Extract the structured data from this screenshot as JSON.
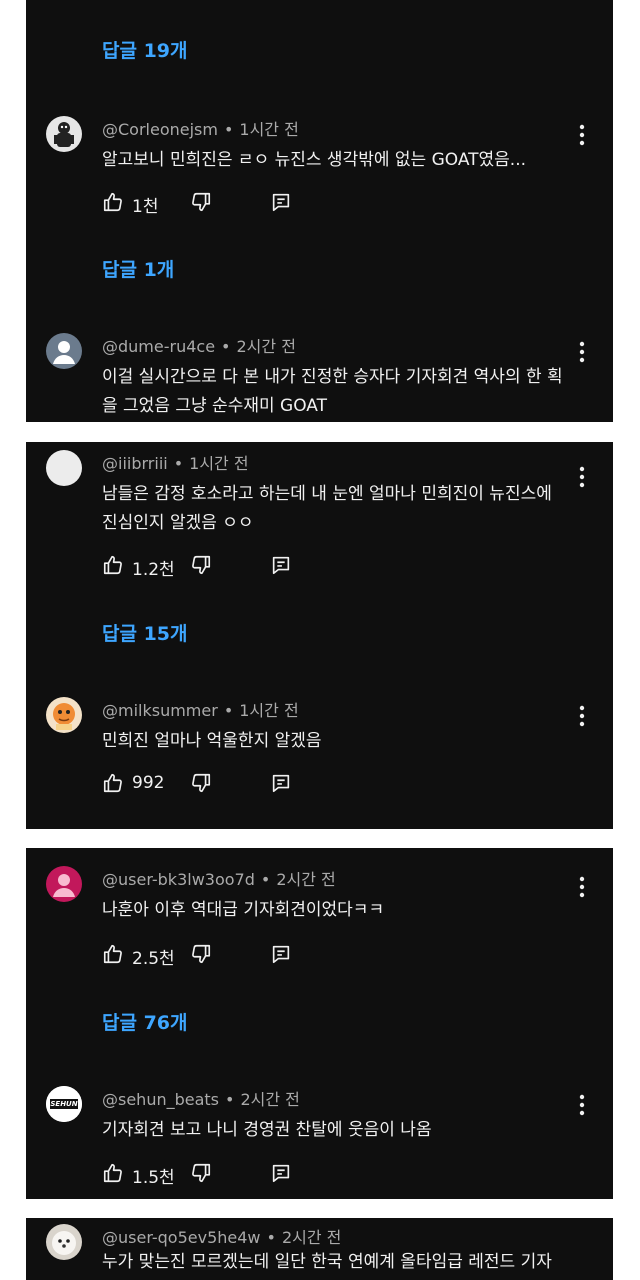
{
  "panel1": {
    "top_replies": "답글 19개",
    "comment": {
      "handle": "@Corleonejsm",
      "time": "1시간 전",
      "text": "알고보니 민희진은 ㄹㅇ 뉴진스 생각밖에 없는 GOAT였음...",
      "likes": "1천"
    },
    "replies": "답글 1개",
    "comment2": {
      "handle": "@dume-ru4ce",
      "time": "2시간 전",
      "text": "이걸 실시간으로 다 본 내가 진정한 승자다 기자회견 역사의 한 획을 그었음 그냥 순수재미 GOAT"
    }
  },
  "panel2": {
    "comment": {
      "handle": "@iiibrriii",
      "time": "1시간 전",
      "text": "남들은 감정 호소라고 하는데 내 눈엔 얼마나 민희진이 뉴진스에 진심인지 알겠음 ㅇㅇ",
      "likes": "1.2천"
    },
    "replies": "답글 15개",
    "comment2": {
      "handle": "@milksummer",
      "time": "1시간 전",
      "text": "민희진 얼마나 억울한지 알겠음",
      "likes": "992"
    }
  },
  "panel3": {
    "comment": {
      "handle": "@user-bk3lw3oo7d",
      "time": "2시간 전",
      "text": "나훈아 이후 역대급 기자회견이었다ㅋㅋ",
      "likes": "2.5천"
    },
    "replies": "답글 76개",
    "comment2": {
      "handle": "@sehun_beats",
      "time": "2시간 전",
      "text": "기자회견 보고 나니 경영권 찬탈에 웃음이 나옴",
      "likes": "1.5천",
      "avatar_text": "SEHUN"
    }
  },
  "panel4": {
    "comment": {
      "handle": "@user-qo5ev5he4w",
      "time": "2시간 전",
      "text": "누가 맞는진 모르겠는데 일단 한국 연예계 올타임급 레전드 기자"
    }
  },
  "colors": {
    "panel_bg": "#0f0f0f",
    "link_blue": "#3ea6ff",
    "text": "#f1f1f1",
    "meta": "#aaaaaa"
  },
  "icons": [
    "thumbs-up-icon",
    "thumbs-down-icon",
    "reply-icon",
    "more-vert-icon"
  ]
}
